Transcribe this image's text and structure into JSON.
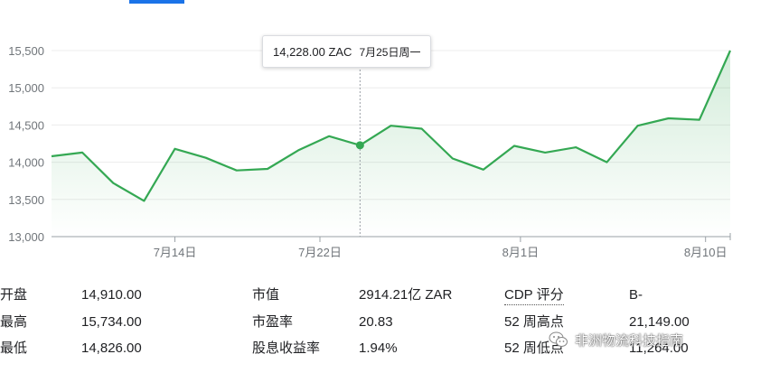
{
  "tooltip": {
    "value": "14,228.00 ZAC",
    "date": "7月25日周一"
  },
  "chart_data": {
    "type": "area",
    "title": "",
    "xlabel": "",
    "ylabel": "",
    "ylim": [
      13000,
      15650
    ],
    "yticks": [
      "15,500",
      "15,000",
      "14,500",
      "14,000",
      "13,500",
      "13,000"
    ],
    "ytick_values": [
      15500,
      15000,
      14500,
      14000,
      13500,
      13000
    ],
    "xticks": [
      "7月14日",
      "7月22日",
      "8月1日",
      "8月10日"
    ],
    "xtick_index": [
      4.0,
      8.7,
      15.2,
      21.2
    ],
    "series": [
      {
        "values": [
          14080,
          14130,
          13720,
          13480,
          14180,
          14060,
          13890,
          13910,
          14160,
          14350,
          14228,
          14490,
          14450,
          14050,
          13900,
          14220,
          14130,
          14200,
          14000,
          14490,
          14590,
          14570,
          15500
        ]
      }
    ],
    "highlight_index": 10,
    "line_color": "#34a853",
    "fill_color": "#34a853",
    "grid": true
  },
  "stats": [
    {
      "label": "开盘",
      "value": "14,910.00"
    },
    {
      "label": "最高",
      "value": "15,734.00"
    },
    {
      "label": "最低",
      "value": "14,826.00"
    },
    {
      "label": "市值",
      "value": "2914.21亿 ZAR"
    },
    {
      "label": "市盈率",
      "value": "20.83"
    },
    {
      "label": "股息收益率",
      "value": "1.94%"
    },
    {
      "label": "CDP 评分",
      "value": "B-"
    },
    {
      "label": "52 周高点",
      "value": "21,149.00"
    },
    {
      "label": "52 周低点",
      "value": "11,264.00"
    }
  ],
  "watermark": {
    "text": "非洲物流科技指南",
    "icon": "wechat-icon"
  }
}
